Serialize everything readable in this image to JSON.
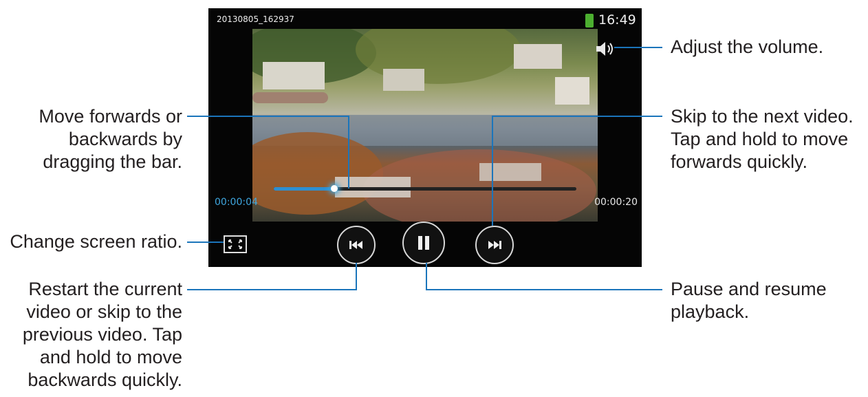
{
  "player": {
    "filename": "20130805_162937",
    "clock": "16:49",
    "elapsed": "00:00:04",
    "duration": "00:00:20",
    "progress": 0.2
  },
  "annotations": {
    "volume": "Adjust the volume.",
    "seek": [
      "Move forwards or",
      "backwards by",
      "dragging the bar."
    ],
    "next": [
      "Skip to the next video.",
      "Tap and hold to move",
      "forwards quickly."
    ],
    "ratio": "Change screen ratio.",
    "prev": [
      "Restart the current",
      "video or skip to the",
      "previous video. Tap",
      "and hold to move",
      "backwards quickly."
    ],
    "pause": [
      "Pause and resume",
      "playback."
    ]
  },
  "colors": {
    "callout_line": "#1b75bb",
    "progress_fill": "#2d8fd2",
    "elapsed_text": "#3fa7e0",
    "battery": "#4caf30"
  },
  "icons": {
    "battery": "battery-icon",
    "volume": "volume-icon",
    "ratio": "screen-ratio-icon",
    "prev": "previous-icon",
    "pause": "pause-icon",
    "next": "next-icon"
  }
}
